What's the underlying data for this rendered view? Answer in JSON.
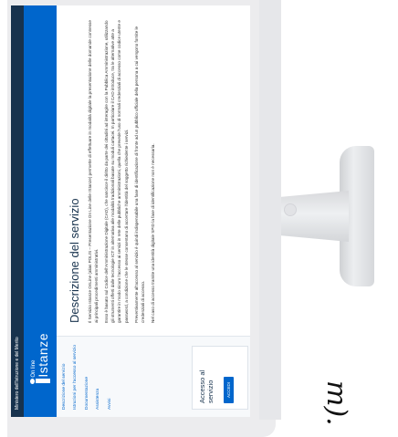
{
  "header": {
    "ministry": "Ministero dell'Istruzione e del Merito",
    "logo_small": "On line",
    "logo_big": "Istanze"
  },
  "sidebar": {
    "items": [
      {
        "label": "Descrizione del servizio"
      },
      {
        "label": "Istruzioni per l'accesso al servizio"
      },
      {
        "label": "Documentazione"
      },
      {
        "label": "Assistenza"
      },
      {
        "label": "Avvisi"
      }
    ],
    "access_title": "Accesso al servizio",
    "access_button": "ACCEDI"
  },
  "main": {
    "title": "Descrizione del servizio",
    "paragraphs": [
      "Il Servizio Istanze OnLine (alias POLIS – Presentazione On Line delle IStanze) permette di effettuare in modalità digitale la presentazione delle domande connesse ai principali procedimenti amministrativi.",
      "Esso è basato sul Codice dell'Amministrazione Digitale (CAD), che sancisce il diritto da parte dei cittadini ad interagire con la Pubblica Amministrazione, utilizzando gli strumenti offerti dalle tecnologie ICT in alternativa alle modalità tradizionali basate su moduli cartacei. In particolare il CAD introduce, tra le alternative atte a garantire in modo sicuro l'accesso ai servizi in rete delle pubbliche amministrazioni, quella che prevede l'uso di normali credenziali di accesso come codice utente e password, a condizione che le stesse consentano di accertare l'identità del soggetto richiedente i servizi.",
      "Preventivamente all'accesso al servizio è quindi indispensabile una fase di identificazione di fronte ad un pubblico ufficiale della persona a cui vengono fornite le credenziali di accesso.",
      "Nel caso di accesso tramite una identità digitale SPID la fase di identificazione non è necessaria."
    ]
  },
  "overlay": {
    "handwriting": "m)."
  }
}
